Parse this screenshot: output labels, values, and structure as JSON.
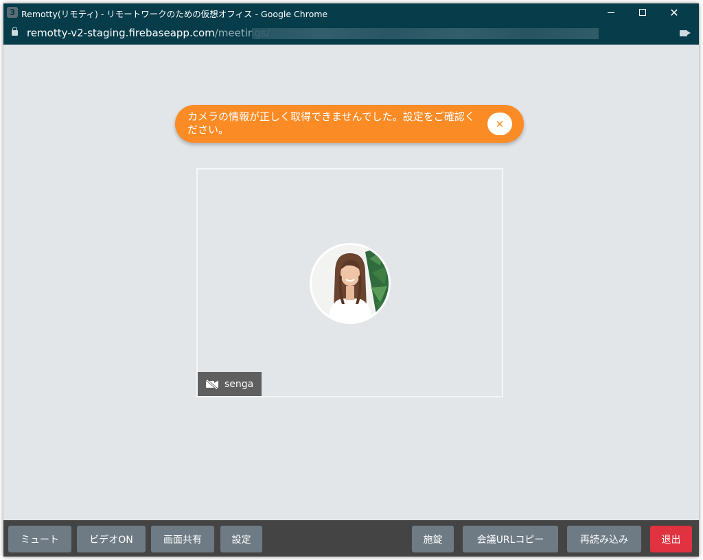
{
  "window": {
    "title": "Remotty(リモティ) - リモートワークのための仮想オフィス - Google Chrome",
    "app_icon_glyph": "3",
    "minimize_icon": "minimize-icon",
    "maximize_icon": "maximize-icon",
    "close_glyph": "✕"
  },
  "address": {
    "host": "remotty-v2-staging.firebaseapp.com",
    "path": "/meetings/"
  },
  "toast": {
    "message": "カメラの情報が正しく取得できませんでした。設定をご確認ください。",
    "close_glyph": "✕",
    "color": "#fb8b25"
  },
  "participant": {
    "name": "senga",
    "video_status_icon": "video-off-icon"
  },
  "toolbar": {
    "mute": "ミュート",
    "video_on": "ビデオON",
    "screen_share": "画面共有",
    "settings": "設定",
    "lock": "施錠",
    "copy_url": "会議URLコピー",
    "reload": "再読み込み",
    "leave": "退出"
  },
  "colors": {
    "titlebar": "#073c4a",
    "background": "#e3e6e9",
    "button": "#6e7b85",
    "danger": "#e0333f",
    "toolbar": "#444444"
  }
}
